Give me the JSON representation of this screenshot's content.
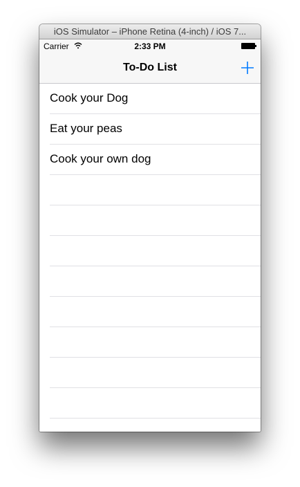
{
  "window": {
    "title": "iOS Simulator – iPhone Retina (4-inch) / iOS 7..."
  },
  "status_bar": {
    "carrier": "Carrier",
    "time": "2:33 PM"
  },
  "nav_bar": {
    "title": "To-Do List",
    "add_icon": "plus-icon"
  },
  "todo_items": [
    {
      "label": "Cook your Dog"
    },
    {
      "label": "Eat your peas"
    },
    {
      "label": "Cook your own dog"
    }
  ],
  "empty_rows": 8,
  "colors": {
    "accent": "#007aff",
    "separator": "#e0e0e4",
    "bar_background": "#f7f7f7"
  }
}
